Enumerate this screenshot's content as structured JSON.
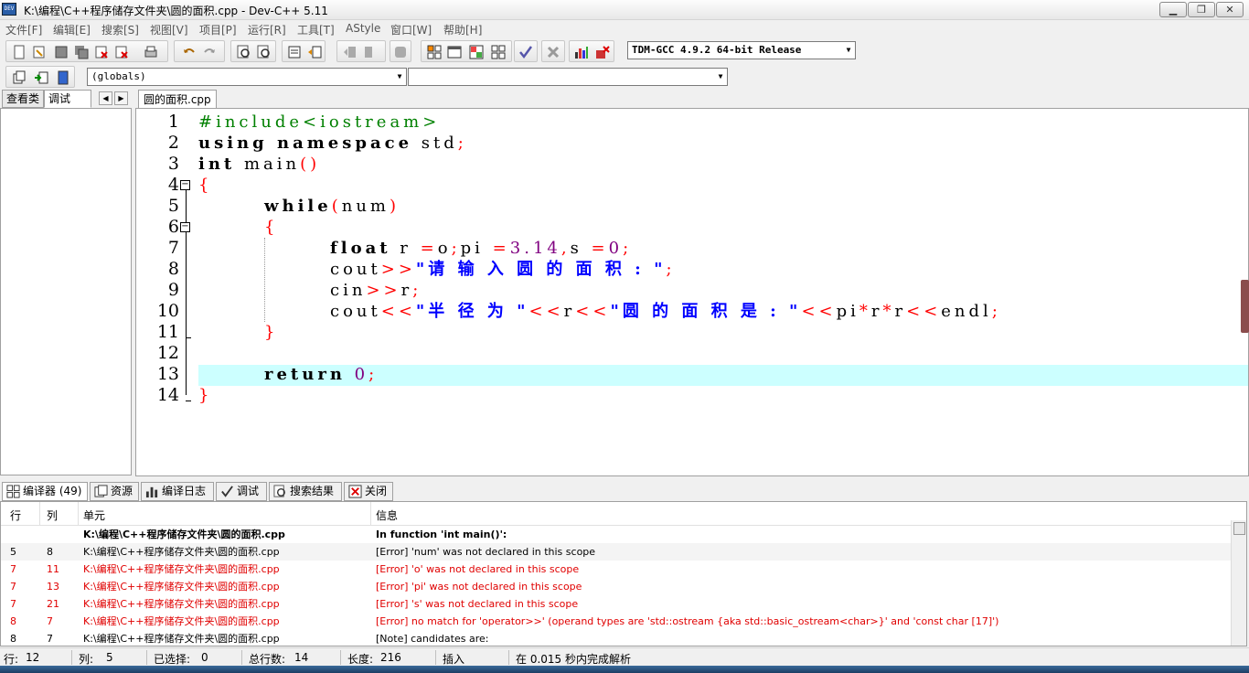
{
  "window": {
    "title": "K:\\编程\\C++程序储存文件夹\\圆的面积.cpp - Dev-C++ 5.11",
    "app_icon": "dev-cpp-icon",
    "buttons": [
      "minimize",
      "maximize",
      "close"
    ]
  },
  "menu": {
    "items": [
      "文件[F]",
      "编辑[E]",
      "搜索[S]",
      "视图[V]",
      "项目[P]",
      "运行[R]",
      "工具[T]",
      "AStyle",
      "窗口[W]",
      "帮助[H]"
    ]
  },
  "toolbar": {
    "compiler_select": "TDM-GCC 4.9.2 64-bit Release",
    "globals_select": "(globals)",
    "member_select": ""
  },
  "left_panel": {
    "tabs": [
      "查看类",
      "调试"
    ],
    "active_tab": "调试"
  },
  "editor": {
    "file_tab": "圆的面积.cpp",
    "line_numbers": [
      "1",
      "2",
      "3",
      "4",
      "5",
      "6",
      "7",
      "8",
      "9",
      "10",
      "11",
      "12",
      "13",
      "14"
    ],
    "current_line": 12,
    "lines": [
      [
        {
          "t": "#include<iostream>",
          "c": "pre"
        }
      ],
      [
        {
          "t": "using namespace",
          "c": "kw"
        },
        {
          "t": " std",
          "c": "id"
        },
        {
          "t": ";",
          "c": "sym"
        }
      ],
      [
        {
          "t": "int",
          "c": "kw"
        },
        {
          "t": " main",
          "c": "id"
        },
        {
          "t": "()",
          "c": "sym"
        }
      ],
      [
        {
          "t": "{",
          "c": "sym"
        }
      ],
      [
        {
          "t": "\t",
          "c": "id"
        },
        {
          "t": "while",
          "c": "kw"
        },
        {
          "t": "(",
          "c": "sym"
        },
        {
          "t": "num",
          "c": "id"
        },
        {
          "t": ")",
          "c": "sym"
        }
      ],
      [
        {
          "t": "\t",
          "c": "id"
        },
        {
          "t": "{",
          "c": "sym"
        }
      ],
      [
        {
          "t": "\t\t",
          "c": "id"
        },
        {
          "t": "float",
          "c": "kw"
        },
        {
          "t": " r ",
          "c": "id"
        },
        {
          "t": "=",
          "c": "sym"
        },
        {
          "t": "o",
          "c": "id"
        },
        {
          "t": ";",
          "c": "sym"
        },
        {
          "t": "pi ",
          "c": "id"
        },
        {
          "t": "=",
          "c": "sym"
        },
        {
          "t": "3.14",
          "c": "num"
        },
        {
          "t": ",",
          "c": "sym"
        },
        {
          "t": "s ",
          "c": "id"
        },
        {
          "t": "=",
          "c": "sym"
        },
        {
          "t": "0",
          "c": "num"
        },
        {
          "t": ";",
          "c": "sym"
        }
      ],
      [
        {
          "t": "\t\t",
          "c": "id"
        },
        {
          "t": "cout",
          "c": "id"
        },
        {
          "t": ">>",
          "c": "sym"
        },
        {
          "t": "\"请 输 入 圆 的 面 积 : \"",
          "c": "str"
        },
        {
          "t": ";",
          "c": "sym"
        }
      ],
      [
        {
          "t": "\t\t",
          "c": "id"
        },
        {
          "t": "cin",
          "c": "id"
        },
        {
          "t": ">>",
          "c": "sym"
        },
        {
          "t": "r",
          "c": "id"
        },
        {
          "t": ";",
          "c": "sym"
        }
      ],
      [
        {
          "t": "\t\t",
          "c": "id"
        },
        {
          "t": "cout",
          "c": "id"
        },
        {
          "t": "<<",
          "c": "sym"
        },
        {
          "t": "\"半 径 为 \"",
          "c": "str"
        },
        {
          "t": "<<",
          "c": "sym"
        },
        {
          "t": "r",
          "c": "id"
        },
        {
          "t": "<<",
          "c": "sym"
        },
        {
          "t": "\"圆 的 面 积 是 : \"",
          "c": "str"
        },
        {
          "t": "<<",
          "c": "sym"
        },
        {
          "t": "pi",
          "c": "id"
        },
        {
          "t": "*",
          "c": "sym"
        },
        {
          "t": "r",
          "c": "id"
        },
        {
          "t": "*",
          "c": "sym"
        },
        {
          "t": "r",
          "c": "id"
        },
        {
          "t": "<<",
          "c": "sym"
        },
        {
          "t": "endl",
          "c": "id"
        },
        {
          "t": ";",
          "c": "sym"
        }
      ],
      [
        {
          "t": "\t",
          "c": "id"
        },
        {
          "t": "}",
          "c": "sym"
        }
      ],
      [
        {
          "t": "",
          "c": "id"
        }
      ],
      [
        {
          "t": "\t",
          "c": "id"
        },
        {
          "t": "return",
          "c": "kw"
        },
        {
          "t": " ",
          "c": "id"
        },
        {
          "t": "0",
          "c": "num"
        },
        {
          "t": ";",
          "c": "sym"
        }
      ],
      [
        {
          "t": "}",
          "c": "sym"
        }
      ]
    ]
  },
  "bottom_tabs": [
    {
      "label": "编译器 (49)",
      "icon": "grid-icon"
    },
    {
      "label": "资源",
      "icon": "resource-icon"
    },
    {
      "label": "编译日志",
      "icon": "bar-chart-icon"
    },
    {
      "label": "调试",
      "icon": "check-icon"
    },
    {
      "label": "搜索结果",
      "icon": "search-icon"
    },
    {
      "label": "关闭",
      "icon": "close-icon"
    }
  ],
  "results": {
    "columns": [
      "行",
      "列",
      "单元",
      "信息"
    ],
    "rows": [
      {
        "line": "",
        "col": "",
        "unit": "K:\\编程\\C++程序储存文件夹\\圆的面积.cpp",
        "msg": "In function 'int main()':",
        "kind": "hdr"
      },
      {
        "line": "5",
        "col": "8",
        "unit": "K:\\编程\\C++程序储存文件夹\\圆的面积.cpp",
        "msg": "[Error] 'num' was not declared in this scope",
        "kind": "sel"
      },
      {
        "line": "7",
        "col": "11",
        "unit": "K:\\编程\\C++程序储存文件夹\\圆的面积.cpp",
        "msg": "[Error] 'o' was not declared in this scope",
        "kind": "err"
      },
      {
        "line": "7",
        "col": "13",
        "unit": "K:\\编程\\C++程序储存文件夹\\圆的面积.cpp",
        "msg": "[Error] 'pi' was not declared in this scope",
        "kind": "err"
      },
      {
        "line": "7",
        "col": "21",
        "unit": "K:\\编程\\C++程序储存文件夹\\圆的面积.cpp",
        "msg": "[Error] 's' was not declared in this scope",
        "kind": "err"
      },
      {
        "line": "8",
        "col": "7",
        "unit": "K:\\编程\\C++程序储存文件夹\\圆的面积.cpp",
        "msg": "[Error] no match for 'operator>>' (operand types are 'std::ostream {aka std::basic_ostream<char>}' and 'const char [17]')",
        "kind": "err"
      },
      {
        "line": "8",
        "col": "7",
        "unit": "K:\\编程\\C++程序储存文件夹\\圆的面积.cpp",
        "msg": "[Note] candidates are:",
        "kind": "note"
      }
    ]
  },
  "status": {
    "line_label": "行:",
    "line_value": "12",
    "col_label": "列:",
    "col_value": "5",
    "sel_label": "已选择:",
    "sel_value": "0",
    "total_label": "总行数:",
    "total_value": "14",
    "len_label": "长度:",
    "len_value": "216",
    "mode": "插入",
    "parse": "在 0.015 秒内完成解析"
  }
}
